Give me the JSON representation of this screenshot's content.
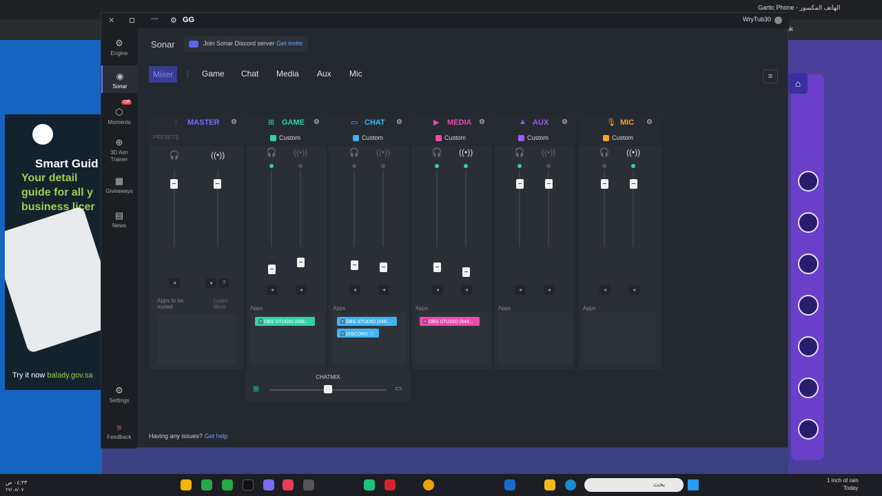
{
  "browser": {
    "tab_title": "Gartic Phone - الهاتف المكسور",
    "url_fragment": "r/book"
  },
  "ad": {
    "line1": "Smart Guid",
    "line2": "Your detail",
    "line3": "guide for all y",
    "line4": "business licer",
    "try_prefix": "Try it now",
    "try_link": "balady.gov.sa"
  },
  "taskbar": {
    "weather_text": "1 inch of rain",
    "weather_sub": "Today",
    "search": "بحث",
    "time": "٠٤:٢٣ ص",
    "date": "٢٧/٠٨/٠٧"
  },
  "window": {
    "app_name": "GG",
    "username": "WryTub30"
  },
  "sidebar": {
    "items": [
      {
        "label": "Engine",
        "icon": "engine-icon"
      },
      {
        "label": "Sonar",
        "icon": "sonar-icon"
      },
      {
        "label": "Moments",
        "icon": "moments-icon",
        "badge": "Off"
      },
      {
        "label": "3D Aim Trainer",
        "icon": "aim-icon"
      },
      {
        "label": "Giveaways",
        "icon": "gift-icon"
      },
      {
        "label": "News",
        "icon": "news-icon"
      },
      {
        "label": "Settings",
        "icon": "gear-icon"
      },
      {
        "label": "Feedback",
        "icon": "feedback-icon"
      }
    ]
  },
  "header": {
    "title": "Sonar",
    "discord_text": "Join Sonar Discord server",
    "discord_link": "Get invite"
  },
  "tabs": [
    "Mixer",
    "Game",
    "Chat",
    "Media",
    "Aux",
    "Mic"
  ],
  "channels": [
    {
      "name": "MASTER",
      "color": "#7c6cff",
      "preset": "PRESETS",
      "apps_label": "Apps to be routed",
      "learn_more": "Learn More",
      "apps": []
    },
    {
      "name": "GAME",
      "color": "#2fd4a4",
      "preset": "Custom",
      "apps_label": "Apps",
      "apps": [
        "OBS STUDIO (648..."
      ]
    },
    {
      "name": "CHAT",
      "color": "#3fb4f2",
      "preset": "Custom",
      "apps_label": "Apps",
      "apps": [
        "OBS STUDIO (648...",
        "DISCORD"
      ]
    },
    {
      "name": "MEDIA",
      "color": "#ef48b0",
      "preset": "Custom",
      "apps_label": "Apps",
      "apps": [
        "OBS STUDIO (648..."
      ]
    },
    {
      "name": "AUX",
      "color": "#9f5bf2",
      "preset": "Custom",
      "apps_label": "Apps",
      "apps": []
    },
    {
      "name": "MIC",
      "color": "#f5a623",
      "preset": "Custom",
      "apps_label": "Apps",
      "apps": []
    }
  ],
  "chatmix": {
    "label": "CHATMIX",
    "position": 0.5
  },
  "footer": {
    "text": "Having any issues?",
    "link": "Get help"
  }
}
